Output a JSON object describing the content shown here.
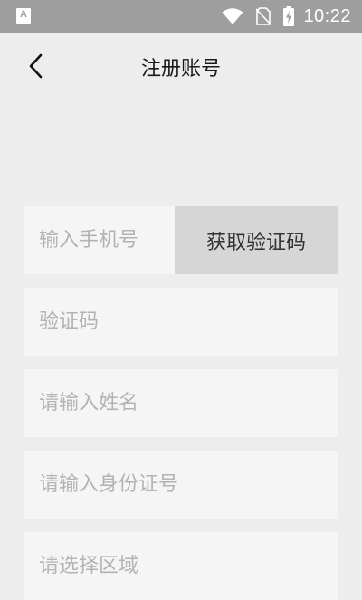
{
  "status_bar": {
    "app_icon": "A",
    "time": "10:22",
    "icons": [
      "wifi-icon",
      "no-sim-icon",
      "battery-charging-icon"
    ]
  },
  "header": {
    "title": "注册账号",
    "back_icon": "chevron-left-icon"
  },
  "form": {
    "phone_placeholder": "输入手机号",
    "get_code_label": "获取验证码",
    "code_placeholder": "验证码",
    "name_placeholder": "请输入姓名",
    "id_placeholder": "请输入身份证号",
    "region_placeholder": "请选择区域"
  },
  "colors": {
    "status_bar": "#9e9e9e",
    "background": "#ededed",
    "field": "#f5f5f5",
    "button": "#d6d6d6"
  }
}
